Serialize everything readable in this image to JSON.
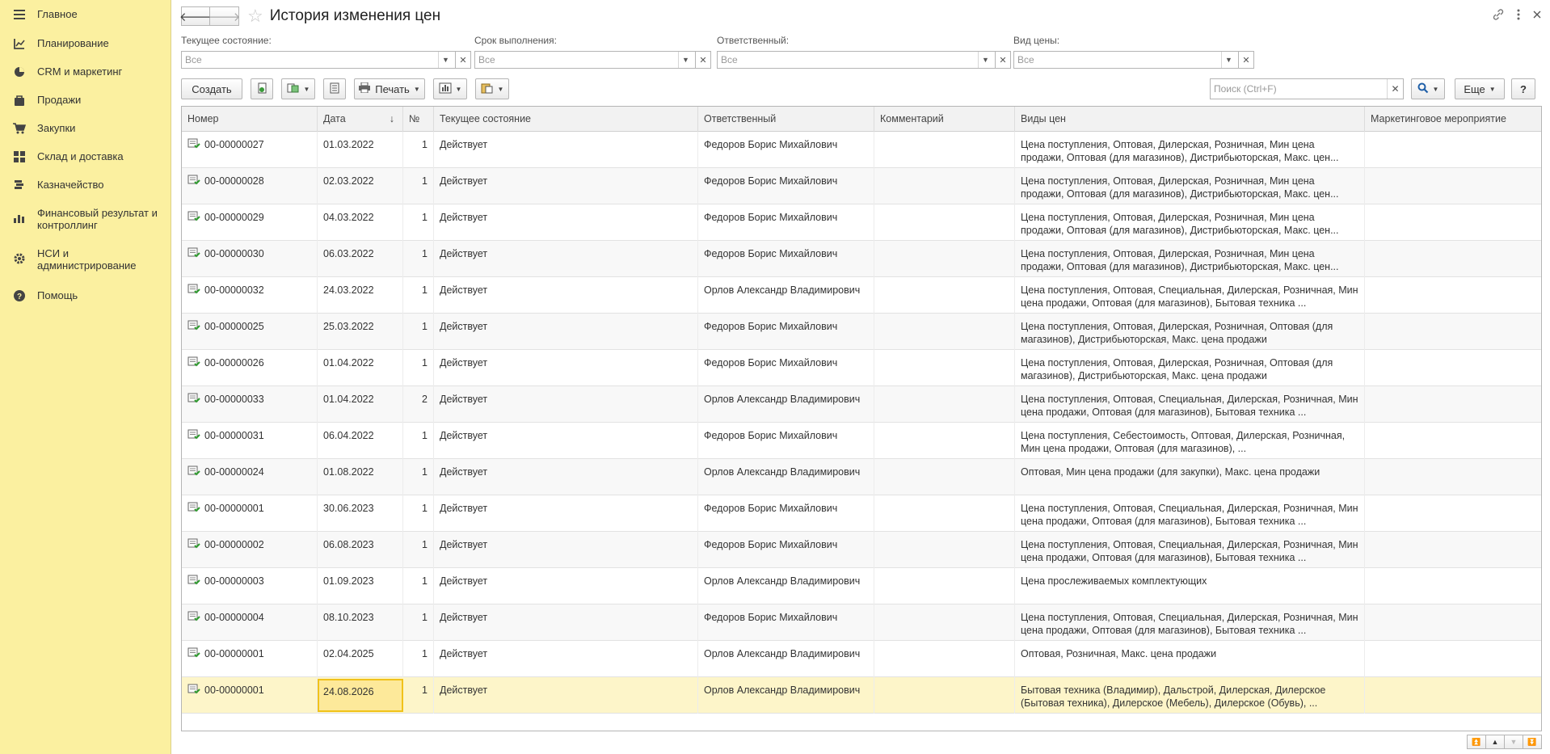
{
  "sidebar": {
    "items": [
      {
        "label": "Главное",
        "icon": "menu-icon"
      },
      {
        "label": "Планирование",
        "icon": "planning-icon"
      },
      {
        "label": "CRM и маркетинг",
        "icon": "pie-chart-icon"
      },
      {
        "label": "Продажи",
        "icon": "bag-icon"
      },
      {
        "label": "Закупки",
        "icon": "cart-icon"
      },
      {
        "label": "Склад и доставка",
        "icon": "warehouse-icon"
      },
      {
        "label": "Казначейство",
        "icon": "coins-icon"
      },
      {
        "label": "Финансовый результат и контроллинг",
        "icon": "bar-chart-icon"
      },
      {
        "label": "НСИ и администрирование",
        "icon": "gear-icon"
      },
      {
        "label": "Помощь",
        "icon": "help-icon"
      }
    ]
  },
  "header": {
    "back": "🡐",
    "forward": "🡒",
    "title": "История изменения цен"
  },
  "filters": {
    "state": {
      "label": "Текущее состояние:",
      "value": "Все"
    },
    "deadline": {
      "label": "Срок выполнения:",
      "value": "Все"
    },
    "responsible": {
      "label": "Ответственный:",
      "value": "Все"
    },
    "price_type": {
      "label": "Вид цены:",
      "value": "Все"
    }
  },
  "toolbar": {
    "create": "Создать",
    "print": "Печать",
    "search_placeholder": "Поиск (Ctrl+F)",
    "more": "Еще",
    "help": "?"
  },
  "table": {
    "columns": [
      "Номер",
      "Дата",
      "№",
      "Текущее состояние",
      "Ответственный",
      "Комментарий",
      "Виды цен",
      "Маркетинговое мероприятие"
    ],
    "sort_indicator": "↓",
    "rows": [
      {
        "number": "00-00000027",
        "date": "01.03.2022",
        "n": "1",
        "state": "Действует",
        "responsible": "Федоров Борис Михайлович",
        "comment": "",
        "prices": "Цена поступления, Оптовая, Дилерская, Розничная, Мин цена продажи, Оптовая (для магазинов), Дистрибьюторская, Макс. цен...",
        "campaign": ""
      },
      {
        "number": "00-00000028",
        "date": "02.03.2022",
        "n": "1",
        "state": "Действует",
        "responsible": "Федоров Борис Михайлович",
        "comment": "",
        "prices": "Цена поступления, Оптовая, Дилерская, Розничная, Мин цена продажи, Оптовая (для магазинов), Дистрибьюторская, Макс. цен...",
        "campaign": ""
      },
      {
        "number": "00-00000029",
        "date": "04.03.2022",
        "n": "1",
        "state": "Действует",
        "responsible": "Федоров Борис Михайлович",
        "comment": "",
        "prices": "Цена поступления, Оптовая, Дилерская, Розничная, Мин цена продажи, Оптовая (для магазинов), Дистрибьюторская, Макс. цен...",
        "campaign": ""
      },
      {
        "number": "00-00000030",
        "date": "06.03.2022",
        "n": "1",
        "state": "Действует",
        "responsible": "Федоров Борис Михайлович",
        "comment": "",
        "prices": "Цена поступления, Оптовая, Дилерская, Розничная, Мин цена продажи, Оптовая (для магазинов), Дистрибьюторская, Макс. цен...",
        "campaign": ""
      },
      {
        "number": "00-00000032",
        "date": "24.03.2022",
        "n": "1",
        "state": "Действует",
        "responsible": "Орлов Александр Владимирович",
        "comment": "",
        "prices": "Цена поступления, Оптовая, Специальная, Дилерская, Розничная, Мин цена продажи, Оптовая (для магазинов), Бытовая техника ...",
        "campaign": ""
      },
      {
        "number": "00-00000025",
        "date": "25.03.2022",
        "n": "1",
        "state": "Действует",
        "responsible": "Федоров Борис Михайлович",
        "comment": "",
        "prices": "Цена поступления, Оптовая, Дилерская, Розничная, Оптовая (для магазинов), Дистрибьюторская, Макс. цена продажи",
        "campaign": ""
      },
      {
        "number": "00-00000026",
        "date": "01.04.2022",
        "n": "1",
        "state": "Действует",
        "responsible": "Федоров Борис Михайлович",
        "comment": "",
        "prices": "Цена поступления, Оптовая, Дилерская, Розничная, Оптовая (для магазинов), Дистрибьюторская, Макс. цена продажи",
        "campaign": ""
      },
      {
        "number": "00-00000033",
        "date": "01.04.2022",
        "n": "2",
        "state": "Действует",
        "responsible": "Орлов Александр Владимирович",
        "comment": "",
        "prices": "Цена поступления, Оптовая, Специальная, Дилерская, Розничная, Мин цена продажи, Оптовая (для магазинов), Бытовая техника ...",
        "campaign": ""
      },
      {
        "number": "00-00000031",
        "date": "06.04.2022",
        "n": "1",
        "state": "Действует",
        "responsible": "Федоров Борис Михайлович",
        "comment": "",
        "prices": "Цена поступления, Себестоимость, Оптовая, Дилерская, Розничная, Мин цена продажи, Оптовая (для магазинов), ...",
        "campaign": ""
      },
      {
        "number": "00-00000024",
        "date": "01.08.2022",
        "n": "1",
        "state": "Действует",
        "responsible": "Орлов Александр Владимирович",
        "comment": "",
        "prices": "Оптовая, Мин цена продажи (для закупки), Макс. цена продажи",
        "campaign": ""
      },
      {
        "number": "00-00000001",
        "date": "30.06.2023",
        "n": "1",
        "state": "Действует",
        "responsible": "Федоров Борис Михайлович",
        "comment": "",
        "prices": "Цена поступления, Оптовая, Специальная, Дилерская, Розничная, Мин цена продажи, Оптовая (для магазинов), Бытовая техника ...",
        "campaign": ""
      },
      {
        "number": "00-00000002",
        "date": "06.08.2023",
        "n": "1",
        "state": "Действует",
        "responsible": "Федоров Борис Михайлович",
        "comment": "",
        "prices": "Цена поступления, Оптовая, Специальная, Дилерская, Розничная, Мин цена продажи, Оптовая (для магазинов), Бытовая техника ...",
        "campaign": ""
      },
      {
        "number": "00-00000003",
        "date": "01.09.2023",
        "n": "1",
        "state": "Действует",
        "responsible": "Орлов Александр Владимирович",
        "comment": "",
        "prices": "Цена прослеживаемых комплектующих",
        "campaign": ""
      },
      {
        "number": "00-00000004",
        "date": "08.10.2023",
        "n": "1",
        "state": "Действует",
        "responsible": "Федоров Борис Михайлович",
        "comment": "",
        "prices": "Цена поступления, Оптовая, Специальная, Дилерская, Розничная, Мин цена продажи, Оптовая (для магазинов), Бытовая техника ...",
        "campaign": ""
      },
      {
        "number": "00-00000001",
        "date": "02.04.2025",
        "n": "1",
        "state": "Действует",
        "responsible": "Орлов Александр Владимирович",
        "comment": "",
        "prices": "Оптовая, Розничная, Макс. цена продажи",
        "campaign": ""
      },
      {
        "number": "00-00000001",
        "date": "24.08.2026",
        "n": "1",
        "state": "Действует",
        "responsible": "Орлов Александр Владимирович",
        "comment": "",
        "prices": "Бытовая техника (Владимир), Дальстрой, Дилерская, Дилерское (Бытовая техника), Дилерское (Мебель), Дилерское (Обувь), ...",
        "campaign": ""
      }
    ]
  },
  "colors": {
    "sidebar_bg": "#fbf0a0",
    "selected_row": "#fdf5c9",
    "focus_cell": "#f0c21a"
  }
}
